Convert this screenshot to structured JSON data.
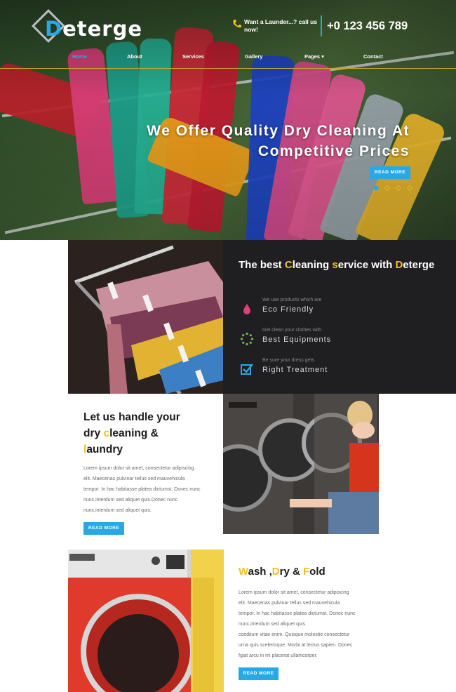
{
  "brand": {
    "logo_first": "D",
    "logo_rest": "eterge"
  },
  "header": {
    "phone_note": "Want a Launder...? call us now!",
    "phone_number": "+0 123 456 789"
  },
  "nav": {
    "items": [
      "Home",
      "About",
      "Services",
      "Gallery",
      "Pages ▾",
      "Contact"
    ]
  },
  "hero": {
    "title_line1": "We Offer Quality Dry Cleaning At",
    "title_line2": "Competitive Prices",
    "button": "READ MORE",
    "slide_count": 4,
    "active_slide": 1
  },
  "features_panel": {
    "title_parts": [
      "The best ",
      "C",
      "leaning ",
      "s",
      "ervice with ",
      "D",
      "eterge"
    ],
    "features": [
      {
        "sub": "We use products which are",
        "main": "Eco Friendly",
        "icon": "drop-icon"
      },
      {
        "sub": "Get clean your clothes with",
        "main": "Best Equipments",
        "icon": "dots-circle-icon"
      },
      {
        "sub": "Be sure your dress gets",
        "main": "Right Treatment",
        "icon": "checkbox-icon"
      }
    ]
  },
  "section_handle": {
    "title_parts": [
      "Let us handle your",
      "dry ",
      "c",
      "leaning &",
      "l",
      "aundry"
    ],
    "paragraph_lines": [
      "Lorem ipsum dolor sit amet, consectetur adipiscing",
      "elit. Maecenas pulvinar tellus sed mauvehicula",
      "tempor. In hac habitasse platea dictumst. Donec nunc",
      "nunc,interdum sed aliquet quis.Donec nunc",
      "nunc,interdum sed aliquet quis."
    ],
    "button": "READ MORE"
  },
  "section_wash": {
    "title_parts": [
      "W",
      "ash ,",
      "D",
      "ry & ",
      "F",
      "old"
    ],
    "paragraph_lines": [
      "Lorem ipsum dolor sit amet, consectetur adipiscing",
      "elit. Maecenas pulvinar tellus sed mauvehicula",
      "tempor. In hac habitasse platea dictumst. Donec nunc",
      "nunc,interdum sed aliquet quis.",
      "conditum vitae enim. Quisque molestie consectetur",
      "urna quis scelerisque. Morbi at lectus sapien. Donec",
      "fgiat arcu in mi placerat ullamcorper."
    ],
    "button": "READ MORE"
  },
  "colors": {
    "accent": "#29a8e8",
    "highlight": "#f3c21e",
    "dark_panel": "#1f1f21"
  }
}
